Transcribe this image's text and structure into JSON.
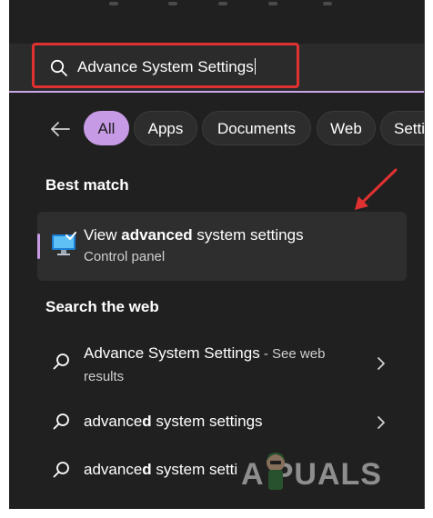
{
  "search": {
    "query": "Advance System Settings"
  },
  "filters": {
    "chips": [
      "All",
      "Apps",
      "Documents",
      "Web",
      "Setti"
    ]
  },
  "best_match": {
    "heading": "Best match",
    "title_prefix": "View ",
    "title_bold": "advanced",
    "title_suffix": " system settings",
    "subtitle": "Control panel"
  },
  "search_web": {
    "heading": "Search the web",
    "items": [
      {
        "text": "Advance System Settings",
        "note": " - See web",
        "note2": "results"
      },
      {
        "text_normal": "advance",
        "text_bold": "d",
        "text_rest": " system settings"
      },
      {
        "text_normal": "advance",
        "text_bold": "d",
        "text_rest": " system setti"
      }
    ]
  },
  "watermark": {
    "text": "A  PUALS"
  },
  "colors": {
    "accent": "#c79ae6",
    "highlight_red": "#e03131",
    "panel": "#202020"
  }
}
